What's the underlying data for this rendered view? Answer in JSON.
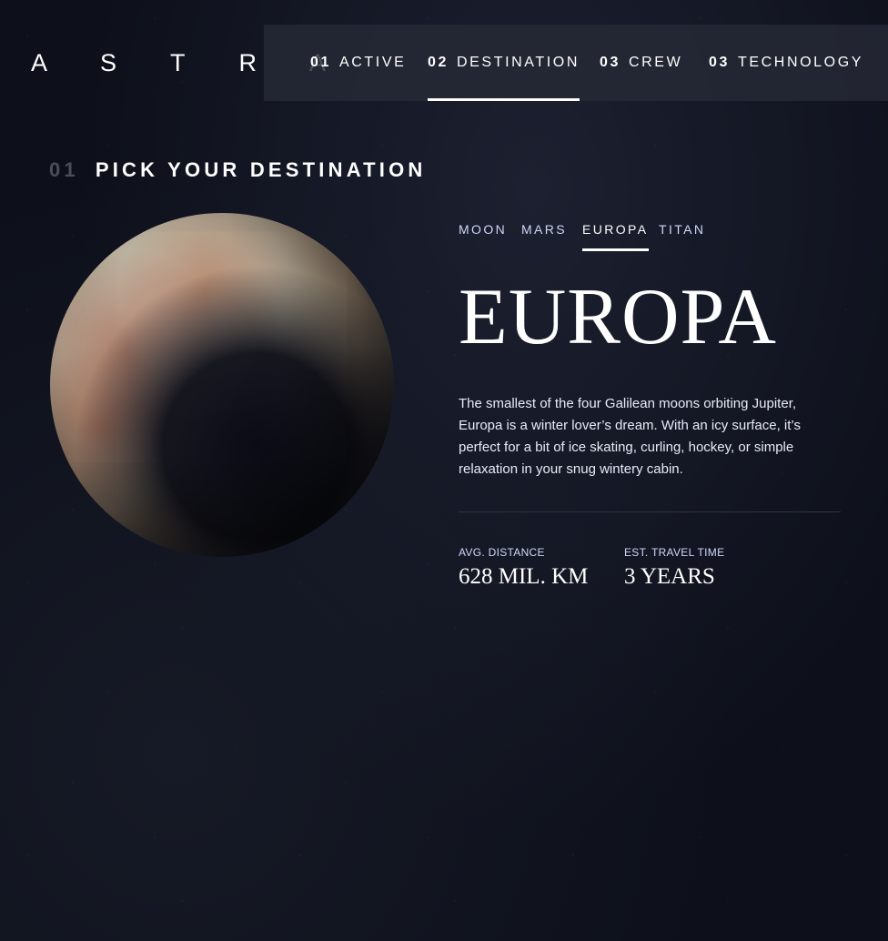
{
  "logo": "A S T R A",
  "nav": {
    "items": [
      {
        "num": "01",
        "label": "ACTIVE"
      },
      {
        "num": "02",
        "label": "DESTINATION"
      },
      {
        "num": "03",
        "label": "CREW"
      },
      {
        "num": "03",
        "label": "TECHNOLOGY"
      }
    ],
    "active_index": 1
  },
  "section": {
    "num": "01",
    "title": "PICK YOUR DESTINATION"
  },
  "tabs": {
    "items": [
      "MOON",
      "MARS",
      "EUROPA",
      "TITAN"
    ],
    "active_index": 2
  },
  "destination": {
    "name": "EUROPA",
    "description": "The smallest of the four Galilean moons orbiting Jupiter, Europa is a winter lover’s dream. With an icy surface, it’s perfect for a bit of ice skating, curling, hockey, or simple relaxation in your snug wintery cabin.",
    "image_icon": "europa-planet-image"
  },
  "stats": {
    "distance": {
      "label": "AVG. DISTANCE",
      "value": "628 MIL. KM"
    },
    "travel": {
      "label": "EST. TRAVEL TIME",
      "value": "3 YEARS"
    }
  },
  "colors": {
    "background": "#0d101a",
    "text": "#ffffff",
    "muted": "#d0d6f9",
    "nav_bg": "#262a36"
  }
}
